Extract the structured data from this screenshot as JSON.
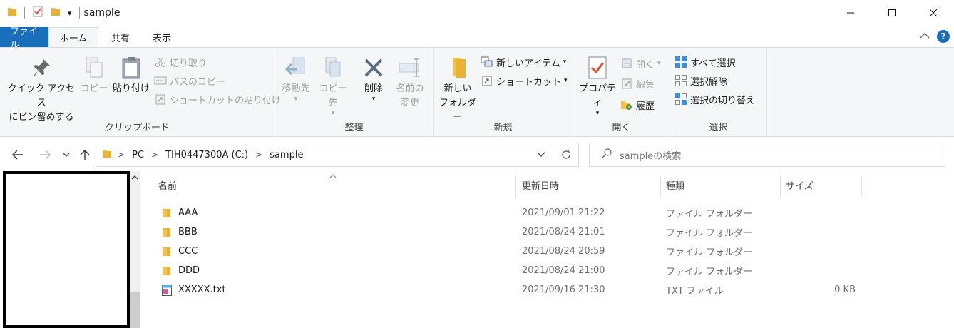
{
  "window": {
    "title": "sample",
    "qat_dropdown": "▾"
  },
  "tabs": [
    {
      "label": "ファイル"
    },
    {
      "label": "ホーム"
    },
    {
      "label": "共有"
    },
    {
      "label": "表示"
    }
  ],
  "ribbon": {
    "clipboard": {
      "label": "クリップボード",
      "pin_line1": "クイック アクセス",
      "pin_line2": "にピン留めする",
      "copy": "コピー",
      "paste": "貼り付け",
      "cut": "切り取り",
      "copy_path": "パスのコピー",
      "paste_shortcut": "ショートカットの貼り付け"
    },
    "organize": {
      "label": "整理",
      "move_to": "移動先",
      "copy_to": "コピー先",
      "delete": "削除",
      "rename_line1": "名前の",
      "rename_line2": "変更"
    },
    "new": {
      "label": "新規",
      "new_folder_line1": "新しい",
      "new_folder_line2": "フォルダー",
      "new_item": "新しいアイテム",
      "shortcut": "ショートカット"
    },
    "open": {
      "label": "開く",
      "properties": "プロパティ",
      "open": "開く",
      "edit": "編集",
      "history": "履歴"
    },
    "select": {
      "label": "選択",
      "select_all": "すべて選択",
      "select_none": "選択解除",
      "invert": "選択の切り替え"
    }
  },
  "address": {
    "crumbs": [
      "PC",
      "TIH0447300A (C:)",
      "sample"
    ],
    "search_placeholder": "sampleの検索"
  },
  "columns": {
    "name": "名前",
    "date": "更新日時",
    "type": "種類",
    "size": "サイズ"
  },
  "files": [
    {
      "name": "AAA",
      "date": "2021/09/01 21:22",
      "type": "ファイル フォルダー",
      "size": "",
      "kind": "folder"
    },
    {
      "name": "BBB",
      "date": "2021/08/24 21:01",
      "type": "ファイル フォルダー",
      "size": "",
      "kind": "folder"
    },
    {
      "name": "CCC",
      "date": "2021/08/24 20:59",
      "type": "ファイル フォルダー",
      "size": "",
      "kind": "folder"
    },
    {
      "name": "DDD",
      "date": "2021/08/24 21:00",
      "type": "ファイル フォルダー",
      "size": "",
      "kind": "folder"
    },
    {
      "name": "XXXXX.txt",
      "date": "2021/09/16 21:30",
      "type": "TXT ファイル",
      "size": "0 KB",
      "kind": "txt"
    }
  ],
  "colors": {
    "file_tab": "#1a6fbd",
    "folder": "#f2c14e",
    "ribbon_bg": "#f5f6f7"
  }
}
